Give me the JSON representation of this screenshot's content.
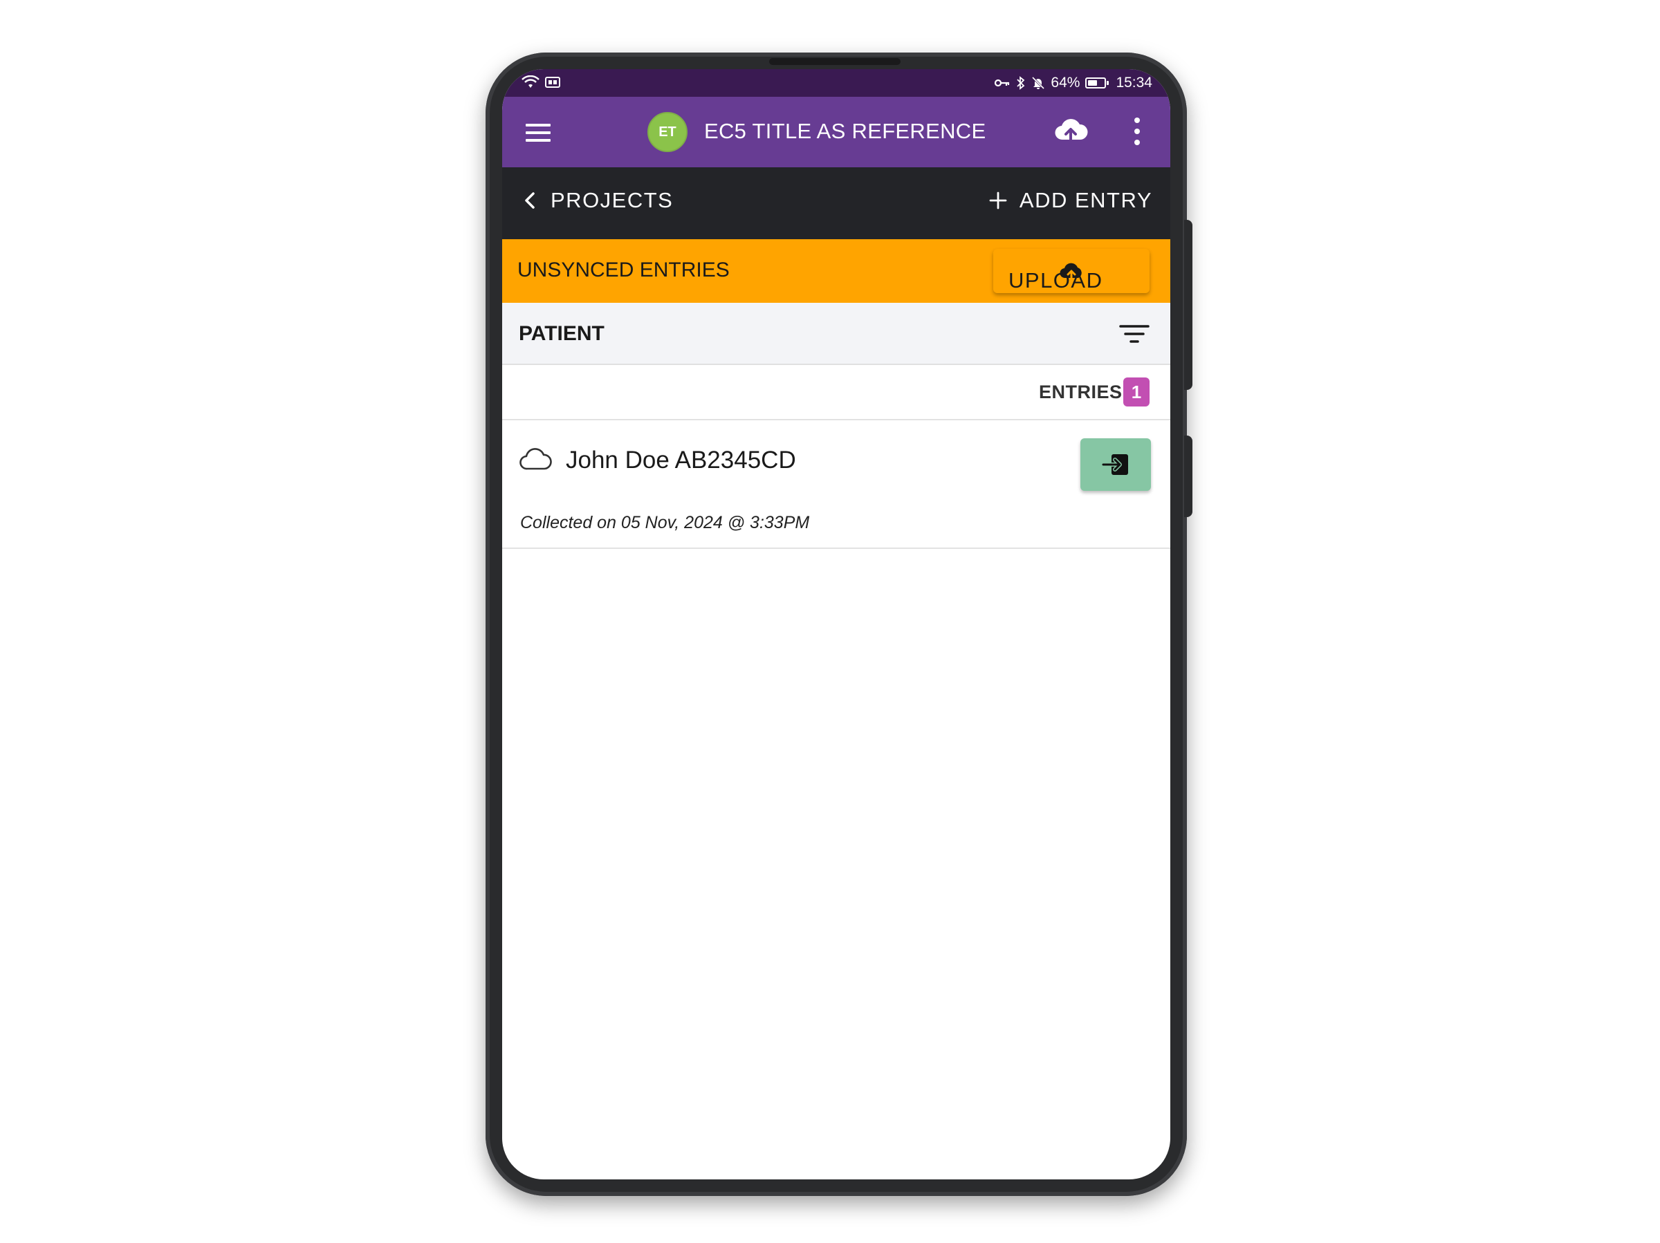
{
  "status_bar": {
    "battery": "64%",
    "time": "15:34",
    "battery_level": 0.64
  },
  "app_bar": {
    "avatar_initials": "ET",
    "title": "EC5 TITLE AS REFERENCE"
  },
  "nav": {
    "back_label": "PROJECTS",
    "add_label": "ADD ENTRY"
  },
  "unsynced": {
    "label": "UNSYNCED ENTRIES",
    "upload_label": "UPLOAD"
  },
  "form": {
    "name": "PATIENT"
  },
  "entries": {
    "label": "ENTRIES",
    "count": "1",
    "items": [
      {
        "title": "John Doe AB2345CD",
        "collected": "Collected on 05 Nov, 2024 @ 3:33PM"
      }
    ]
  },
  "colors": {
    "app_bar": "#673c93",
    "status_bar": "#3a1a52",
    "nav_bar": "#232428",
    "unsynced": "#ffa400",
    "badge": "#c24fb2",
    "open_button": "#86c6a4",
    "avatar": "#8bc34a"
  },
  "icons": {
    "menu": "hamburger-menu-icon",
    "cloud_upload": "cloud-upload-icon",
    "more": "more-vert-icon",
    "back": "chevron-left-icon",
    "add": "plus-icon",
    "filter": "filter-icon",
    "entry_status": "cloud-outline-icon",
    "open_entry": "login-enter-icon"
  }
}
